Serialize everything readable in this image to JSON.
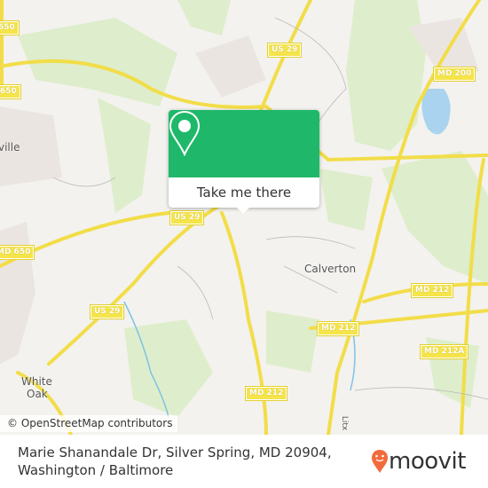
{
  "map": {
    "shields": [
      {
        "label": "650"
      },
      {
        "label": "US 29"
      },
      {
        "label": "MD 200"
      },
      {
        "label": "650"
      },
      {
        "label": "MD 650"
      },
      {
        "label": "US 29"
      },
      {
        "label": "US 29"
      },
      {
        "label": "MD 212"
      },
      {
        "label": "MD 212"
      },
      {
        "label": "MD 212A"
      },
      {
        "label": "MD 212"
      }
    ],
    "places": [
      {
        "label": "ville"
      },
      {
        "label": "Calverton"
      },
      {
        "label": "White"
      },
      {
        "label": "Oak"
      },
      {
        "label": "Litx"
      }
    ],
    "attribution": "© OpenStreetMap contributors"
  },
  "popup": {
    "button_label": "Take me there",
    "color": "#1fb86a",
    "icon": "map-pin-icon"
  },
  "footer": {
    "address_line1": "Marie Shanandale Dr, Silver Spring, MD 20904,",
    "address_line2": "Washington / Baltimore",
    "brand": "moovit",
    "brand_color": "#f26b3a"
  }
}
